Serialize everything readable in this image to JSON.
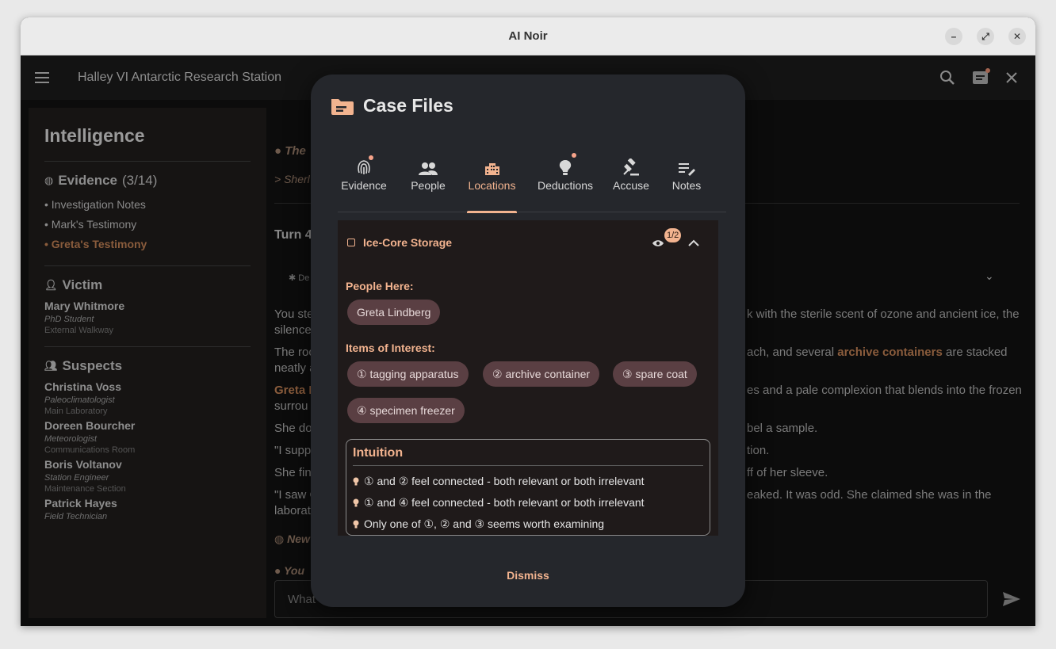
{
  "window": {
    "title": "AI Noir",
    "minimize": "–",
    "maximize": "⤢",
    "close": "✕"
  },
  "appbar": {
    "location": "Halley VI Antarctic Research Station"
  },
  "sidebar": {
    "title": "Intelligence",
    "evidence": {
      "label": "Evidence",
      "count": "(3/14)",
      "items": [
        "• Investigation Notes",
        "• Mark's Testimony",
        "• Greta's Testimony"
      ]
    },
    "victim": {
      "label": "Victim",
      "name": "Mary Whitmore",
      "role": "PhD Student",
      "location": "External Walkway"
    },
    "suspects": {
      "label": "Suspects",
      "people": [
        {
          "name": "Christina Voss",
          "role": "Paleoclimatologist",
          "location": "Main Laboratory"
        },
        {
          "name": "Doreen Bourcher",
          "role": "Meteorologist",
          "location": "Communications Room"
        },
        {
          "name": "Boris Voltanov",
          "role": "Station Engineer",
          "location": "Maintenance Section"
        },
        {
          "name": "Patrick Hayes",
          "role": "Field Technician",
          "location": ""
        }
      ]
    }
  },
  "main": {
    "line1": "The",
    "line2": "> Sherl",
    "turn": "Turn 4",
    "collapsed": "De",
    "p1a": "You ste",
    "p1b": "silence",
    "p1r": "k with the sterile scent of ozone and ancient ice, the",
    "p2a": "The roo",
    "p2b": "neatly a",
    "p2r_pre": "ach, and several ",
    "p2r_hl": "archive containers",
    "p2r_post": " are stacked",
    "p3a": "Greta L",
    "p3b": "surrou",
    "p3r": "es and a pale complexion that blends into the frozen",
    "p4a": "She doe",
    "p4r": "bel a sample.",
    "p5a": "\"I suppo",
    "p5r": "tion.",
    "p6a": "She fin",
    "p6r": "ff of her sleeve.",
    "p7a": "\"I saw C",
    "p7b": "laborat",
    "p7r": "eaked. It was odd. She claimed she was in the",
    "new": "New",
    "you": "You",
    "input_placeholder": "What"
  },
  "dialog": {
    "title": "Case Files",
    "tabs": [
      {
        "label": "Evidence",
        "icon": "fingerprint-icon"
      },
      {
        "label": "People",
        "icon": "people-icon"
      },
      {
        "label": "Locations",
        "icon": "building-icon"
      },
      {
        "label": "Deductions",
        "icon": "lightbulb-icon"
      },
      {
        "label": "Accuse",
        "icon": "gavel-icon"
      },
      {
        "label": "Notes",
        "icon": "notes-icon"
      }
    ],
    "active_tab": "Locations",
    "location": {
      "name": "Ice-Core Storage",
      "badge": "1/2",
      "people_label": "People Here:",
      "people": [
        "Greta Lindberg"
      ],
      "items_label": "Items of Interest:",
      "items": [
        "① tagging apparatus",
        "② archive container",
        "③ spare coat",
        "④ specimen freezer"
      ],
      "intuition_title": "Intuition",
      "intuitions": [
        "① and ② feel connected - both relevant or both irrelevant",
        "① and ④ feel connected - both relevant or both irrelevant",
        "Only one of ①, ② and ③ seems worth examining"
      ]
    },
    "dismiss": "Dismiss"
  },
  "colors": {
    "accent": "#f2b38f",
    "chip": "#5a3f43",
    "dialog_bg": "#25272c"
  }
}
